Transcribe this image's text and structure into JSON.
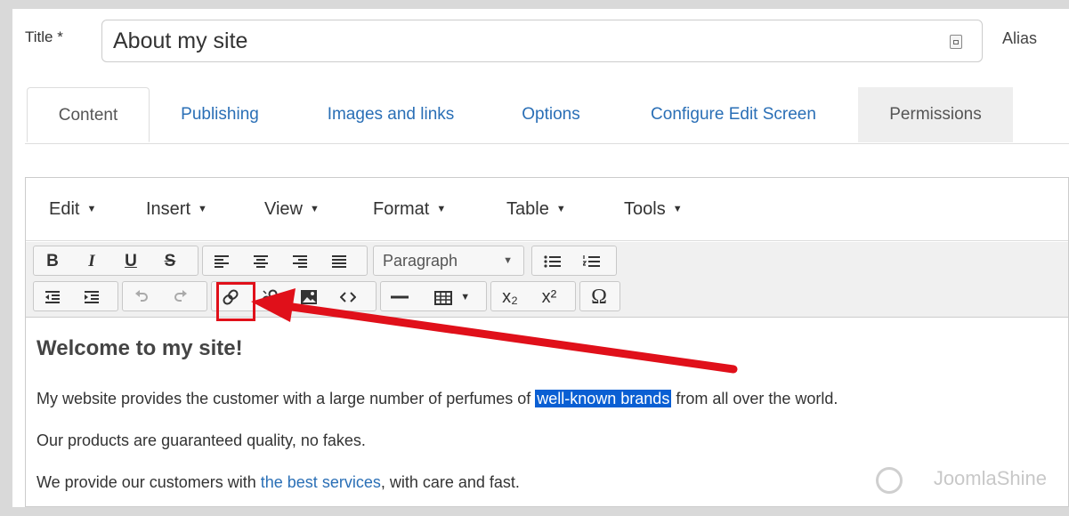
{
  "title_field": {
    "label": "Title *",
    "value": "About my site"
  },
  "alias_label": "Alias",
  "tabs": [
    {
      "label": "Content"
    },
    {
      "label": "Publishing"
    },
    {
      "label": "Images and links"
    },
    {
      "label": "Options"
    },
    {
      "label": "Configure Edit Screen"
    },
    {
      "label": "Permissions"
    }
  ],
  "menubar": [
    "Edit",
    "Insert",
    "View",
    "Format",
    "Table",
    "Tools"
  ],
  "toolbar": {
    "bold": "B",
    "italic": "I",
    "underline": "U",
    "strike": "S",
    "format_select": "Paragraph",
    "subscript": "x₂",
    "superscript": "x²",
    "special_char": "Ω"
  },
  "content": {
    "heading": "Welcome to my site!",
    "p1_before": "My website provides the customer with a large number of perfumes of ",
    "p1_selected": "well-known brands",
    "p1_after": " from all over the world.",
    "p2": "Our products are guaranteed quality, no fakes.",
    "p3_before": "We provide our customers with ",
    "p3_link": "the best services",
    "p3_after": ", with care and fast."
  },
  "watermark": "JoomlaShine",
  "colors": {
    "accent_link": "#2a6fb6",
    "selection": "#0a5fd3",
    "annotation_red": "#e0101a"
  }
}
